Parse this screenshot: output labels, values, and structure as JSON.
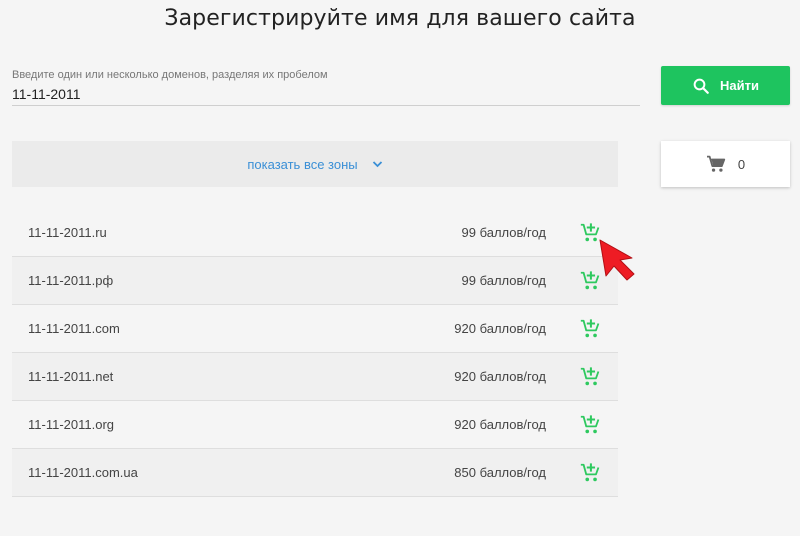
{
  "header": {
    "title": "Зарегистрируйте имя для вашего сайта"
  },
  "search": {
    "hint": "Введите один или несколько доменов, разделяя их пробелом",
    "value": "11-11-2011",
    "button_label": "Найти"
  },
  "zones": {
    "label": "показать все зоны"
  },
  "cart": {
    "count": "0"
  },
  "domains": [
    {
      "name": "11-11-2011.ru",
      "price": "99 баллов/год"
    },
    {
      "name": "11-11-2011.рф",
      "price": "99 баллов/год"
    },
    {
      "name": "11-11-2011.com",
      "price": "920 баллов/год"
    },
    {
      "name": "11-11-2011.net",
      "price": "920 баллов/год"
    },
    {
      "name": "11-11-2011.org",
      "price": "920 баллов/год"
    },
    {
      "name": "11-11-2011.com.ua",
      "price": "850 баллов/год"
    }
  ],
  "colors": {
    "accent_green": "#1ec45f",
    "link_blue": "#3a8fd6",
    "pointer_red": "#ee1c24"
  },
  "icons": {
    "search_button": "search-icon",
    "zones_toggle": "chevron-down-icon",
    "cart": "cart-icon",
    "row_action": "add-to-cart-icon",
    "overlay": "mouse-pointer-arrow"
  }
}
